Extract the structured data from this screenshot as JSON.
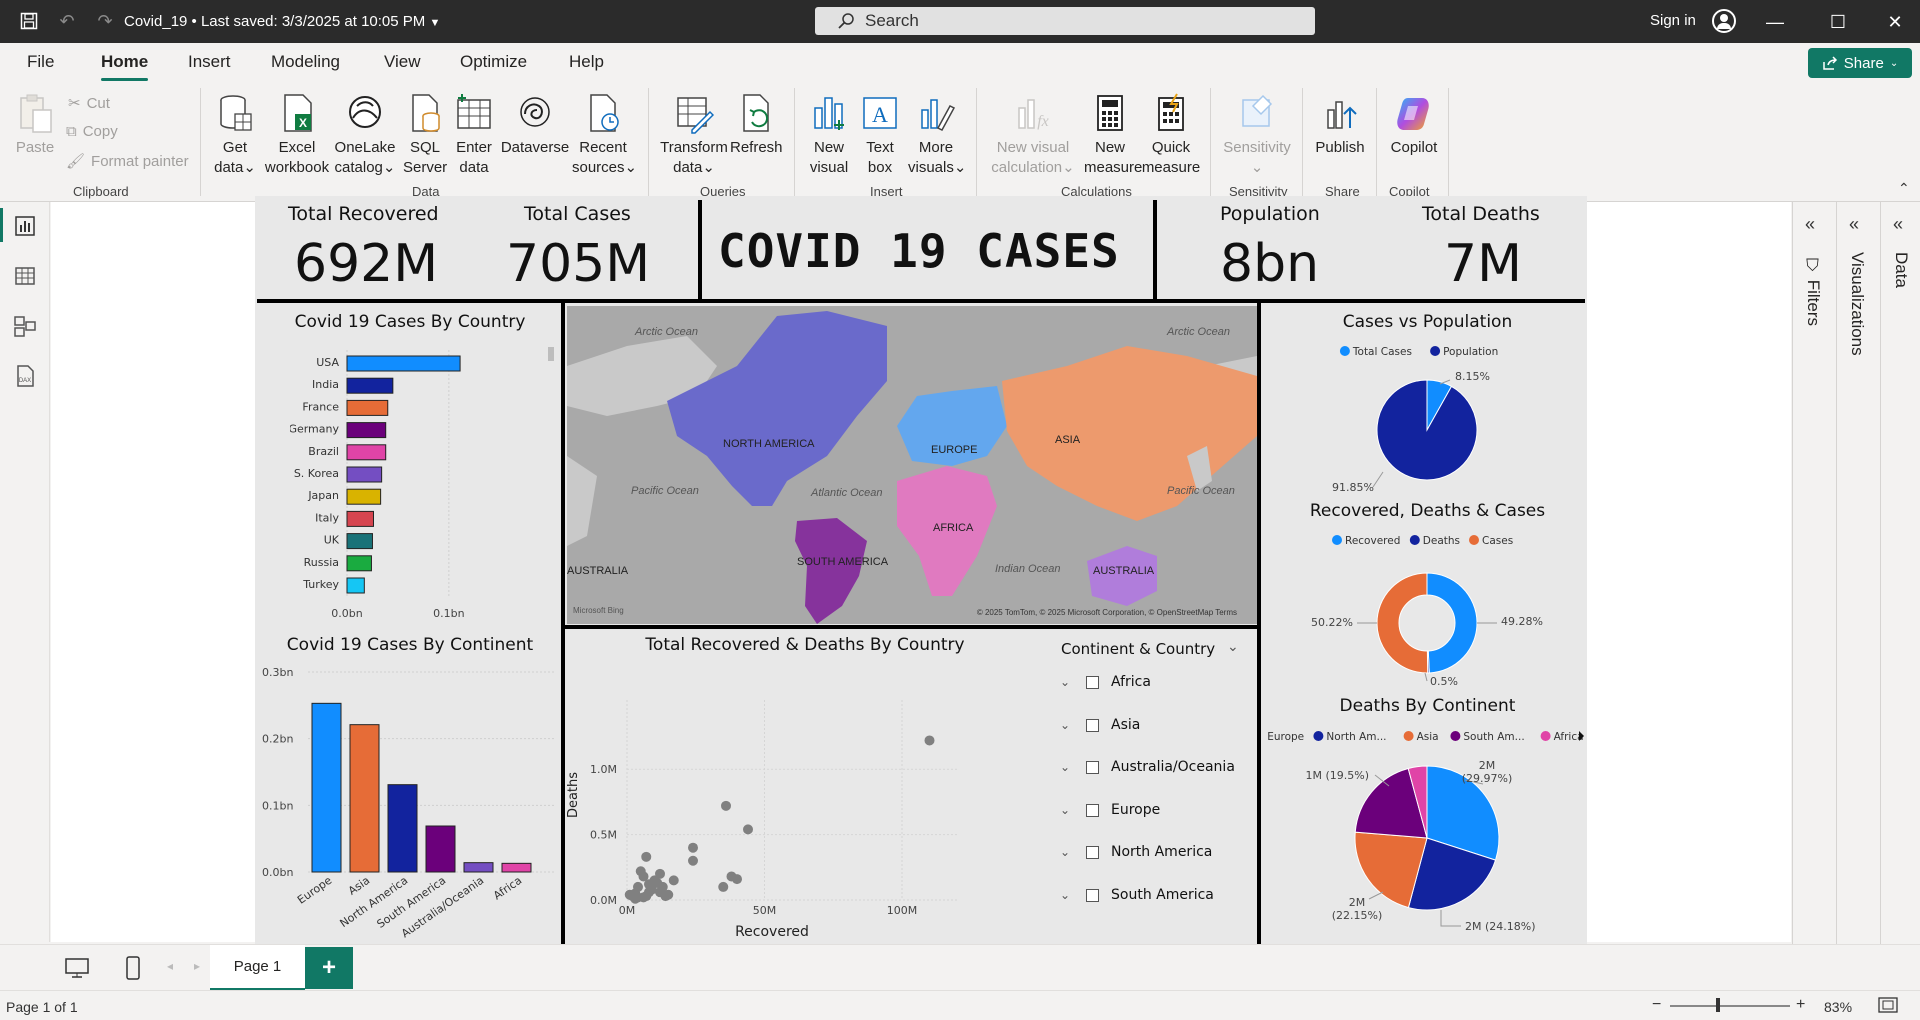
{
  "titlebar": {
    "doc_title": "Covid_19  •  Last saved: 3/3/2025 at 10:05 PM",
    "search_placeholder": "Search",
    "sign_in": "Sign in"
  },
  "menu": {
    "items": [
      "File",
      "Home",
      "Insert",
      "Modeling",
      "View",
      "Optimize",
      "Help"
    ],
    "active": "Home",
    "share": "Share"
  },
  "ribbon": {
    "clipboard": {
      "paste": "Paste",
      "cut": "Cut",
      "copy": "Copy",
      "format_painter": "Format painter",
      "label": "Clipboard"
    },
    "data": {
      "get_data_1": "Get",
      "get_data_2": "data",
      "excel_1": "Excel",
      "excel_2": "workbook",
      "onelake_1": "OneLake",
      "onelake_2": "catalog",
      "sql_1": "SQL",
      "sql_2": "Server",
      "enter_1": "Enter",
      "enter_2": "data",
      "dataverse": "Dataverse",
      "recent_1": "Recent",
      "recent_2": "sources",
      "label": "Data"
    },
    "queries": {
      "transform_1": "Transform",
      "transform_2": "data",
      "refresh": "Refresh",
      "label": "Queries"
    },
    "insert": {
      "new_visual_1": "New",
      "new_visual_2": "visual",
      "text_box_1": "Text",
      "text_box_2": "box",
      "more_visuals_1": "More",
      "more_visuals_2": "visuals",
      "label": "Insert"
    },
    "calculations": {
      "new_visual_calc_1": "New visual",
      "new_visual_calc_2": "calculation",
      "new_measure_1": "New",
      "new_measure_2": "measure",
      "quick_measure_1": "Quick",
      "quick_measure_2": "measure",
      "label": "Calculations"
    },
    "sensitivity": {
      "button": "Sensitivity",
      "label": "Sensitivity"
    },
    "share": {
      "publish": "Publish",
      "label": "Share"
    },
    "copilot": {
      "button": "Copilot",
      "label": "Copilot"
    }
  },
  "report": {
    "kpis": {
      "total_recovered_label": "Total Recovered",
      "total_recovered_value": "692M",
      "total_cases_label": "Total Cases",
      "total_cases_value": "705M",
      "population_label": "Population",
      "population_value": "8bn",
      "total_deaths_label": "Total Deaths",
      "total_deaths_value": "7M"
    },
    "main_title": "COVID 19 CASES",
    "map": {
      "oceans": [
        "Arctic Ocean",
        "Arctic Ocean",
        "Pacific Ocean",
        "Atlantic Ocean",
        "Pacific Ocean",
        "Indian Ocean"
      ],
      "regions": {
        "north_america": "NORTH AMERICA",
        "europe": "EUROPE",
        "asia": "ASIA",
        "africa": "AFRICA",
        "south_america": "SOUTH AMERICA",
        "australia_w": "AUSTRALIA",
        "australia_e": "AUSTRALIA"
      },
      "attribution": "© 2025 TomTom, © 2025 Microsoft Corporation, © OpenStreetMap  Terms",
      "logo": "Microsoft Bing",
      "colors": {
        "north_america": "#6a6acb",
        "europe": "#63a7ee",
        "asia": "#ed9a6d",
        "africa": "#e07ac0",
        "south_america": "#86339c",
        "australia": "#b07ddb",
        "land": "#c9c9c9",
        "water": "#a9a9a9"
      }
    },
    "slicer": {
      "title": "Continent & Country",
      "items": [
        "Africa",
        "Asia",
        "Australia/Oceania",
        "Europe",
        "North America",
        "South America"
      ]
    }
  },
  "chart_data": [
    {
      "type": "bar",
      "orientation": "horizontal",
      "title": "Covid 19 Cases By Country",
      "categories": [
        "USA",
        "India",
        "France",
        "Germany",
        "Brazil",
        "S. Korea",
        "Japan",
        "Italy",
        "UK",
        "Russia",
        "Turkey"
      ],
      "values": [
        0.111,
        0.045,
        0.04,
        0.038,
        0.038,
        0.034,
        0.033,
        0.026,
        0.025,
        0.024,
        0.017
      ],
      "colors": [
        "#118dff",
        "#12239e",
        "#e66c37",
        "#6b007b",
        "#e044a7",
        "#744ec2",
        "#d9b300",
        "#d64550",
        "#197278",
        "#1aab40",
        "#15c6f4"
      ],
      "xticks": [
        "0.0bn",
        "0.1bn"
      ],
      "xlim": [
        0,
        0.16
      ]
    },
    {
      "type": "bar",
      "title": "Covid 19 Cases By Continent",
      "categories": [
        "Europe",
        "Asia",
        "North America",
        "South America",
        "Australia/Oceania",
        "Africa"
      ],
      "values": [
        0.253,
        0.221,
        0.131,
        0.069,
        0.014,
        0.013
      ],
      "colors": [
        "#118dff",
        "#e66c37",
        "#12239e",
        "#6b007b",
        "#744ec2",
        "#e044a7"
      ],
      "yticks": [
        "0.0bn",
        "0.1bn",
        "0.2bn",
        "0.3bn"
      ],
      "ylim": [
        0,
        0.3
      ]
    },
    {
      "type": "scatter",
      "title": "Total Recovered & Deaths By Country",
      "xlabel": "Recovered",
      "ylabel": "Deaths",
      "xticks": [
        "0M",
        "50M",
        "100M"
      ],
      "yticks": [
        "0.0M",
        "0.5M",
        "1.0M"
      ],
      "xlim": [
        0,
        120
      ],
      "ylim": [
        0,
        1.3
      ],
      "x": [
        110,
        36,
        44,
        24,
        7,
        12,
        17,
        24,
        35,
        38,
        40,
        3,
        4,
        6,
        8,
        10,
        12,
        14,
        5,
        2,
        9,
        11,
        13,
        15,
        6,
        8,
        3,
        4,
        7,
        1
      ],
      "y": [
        1.22,
        0.72,
        0.54,
        0.4,
        0.33,
        0.2,
        0.15,
        0.3,
        0.1,
        0.18,
        0.16,
        0.05,
        0.1,
        0.18,
        0.12,
        0.15,
        0.06,
        0.03,
        0.22,
        0.03,
        0.08,
        0.13,
        0.1,
        0.04,
        0.02,
        0.06,
        0.01,
        0.02,
        0.03,
        0.04
      ]
    },
    {
      "type": "pie",
      "title": "Cases vs Population",
      "legend": [
        "Total Cases",
        "Population"
      ],
      "values": [
        8.15,
        91.85
      ],
      "labels": [
        "8.15%",
        "91.85%"
      ],
      "colors": [
        "#118dff",
        "#12239e"
      ]
    },
    {
      "type": "pie",
      "variant": "donut",
      "title": "Recovered, Deaths & Cases",
      "legend": [
        "Recovered",
        "Deaths",
        "Cases"
      ],
      "values": [
        49.28,
        0.5,
        50.22
      ],
      "labels": [
        "49.28%",
        "0.5%",
        "50.22%"
      ],
      "colors": [
        "#118dff",
        "#12239e",
        "#e66c37"
      ]
    },
    {
      "type": "pie",
      "title": "Deaths By Continent",
      "legend": [
        "Europe",
        "North Am...",
        "Asia",
        "South Am...",
        "Africa"
      ],
      "values": [
        29.97,
        24.18,
        22.15,
        19.5,
        4.2
      ],
      "labels": [
        "2M (29.97%)",
        "2M (24.18%)",
        "2M (22.15%)",
        "1M (19.5%)",
        ""
      ],
      "colors": [
        "#118dff",
        "#12239e",
        "#e66c37",
        "#6b007b",
        "#e044a7"
      ]
    }
  ],
  "panes": {
    "filters": "Filters",
    "visualizations": "Visualizations",
    "data": "Data"
  },
  "tabs": {
    "page1": "Page 1",
    "add": "+"
  },
  "status": {
    "page_count": "Page 1 of 1",
    "zoom": "83%"
  }
}
